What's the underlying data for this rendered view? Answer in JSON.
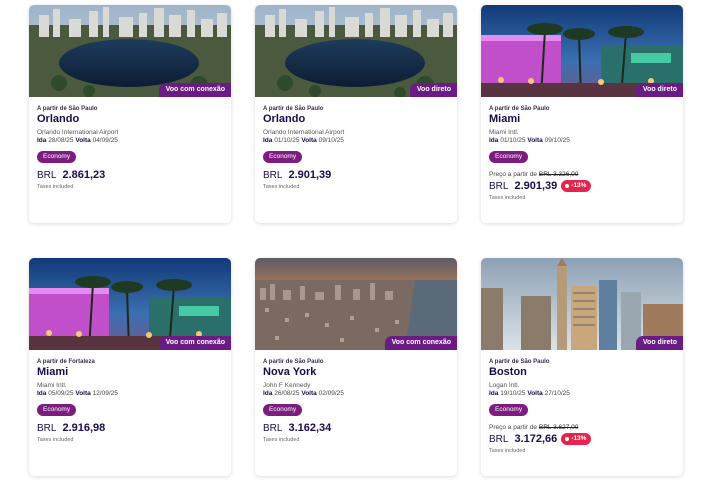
{
  "colors": {
    "badge_bg": "#6a1b84",
    "chip_bg": "#7b1c7e",
    "discount_bg": "#e6254f",
    "text_dark": "#1b0a4a"
  },
  "cards": [
    {
      "badge": "Voo com conexão",
      "origin": "A partir de São Paulo",
      "city": "Orlando",
      "airport": "Orlando International Airport",
      "ida_label": "Ida",
      "ida_date": "28/08/25",
      "volta_label": "Volta",
      "volta_date": "04/09/25",
      "fare": "Economy",
      "currency": "BRL",
      "price": "2.861,23",
      "taxes": "Taxes included",
      "image": "lake-city-skyline"
    },
    {
      "badge": "Voo direto",
      "origin": "A partir de São Paulo",
      "city": "Orlando",
      "airport": "Orlando International Airport",
      "ida_label": "Ida",
      "ida_date": "01/10/25",
      "volta_label": "Volta",
      "volta_date": "09/10/25",
      "fare": "Economy",
      "currency": "BRL",
      "price": "2.901,39",
      "taxes": "Taxes included",
      "image": "lake-city-skyline"
    },
    {
      "badge": "Voo direto",
      "origin": "A partir de São Paulo",
      "city": "Miami",
      "airport": "Miami Intl.",
      "ida_label": "Ida",
      "ida_date": "01/10/25",
      "volta_label": "Volta",
      "volta_date": "09/10/25",
      "fare": "Economy",
      "from_price_label": "Preço a partir de",
      "old_price": "BRL 3.326,00",
      "currency": "BRL",
      "price": "2.901,39",
      "discount": "-13%",
      "taxes": "Taxes included",
      "image": "neon-palm-street"
    },
    {
      "badge": "Voo com conexão",
      "origin": "A partir de Fortaleza",
      "city": "Miami",
      "airport": "Miami Intl.",
      "ida_label": "Ida",
      "ida_date": "05/09/25",
      "volta_label": "Volta",
      "volta_date": "12/09/25",
      "fare": "Economy",
      "currency": "BRL",
      "price": "2.916,98",
      "taxes": "Taxes included",
      "image": "neon-palm-street"
    },
    {
      "badge": "Voo com conexão",
      "origin": "A partir de São Paulo",
      "city": "Nova York",
      "airport": "John F Kennedy",
      "ida_label": "Ida",
      "ida_date": "26/08/25",
      "volta_label": "Volta",
      "volta_date": "02/09/25",
      "fare": "Economy",
      "currency": "BRL",
      "price": "3.162,34",
      "taxes": "Taxes included",
      "image": "aerial-city-sunset"
    },
    {
      "badge": "Voo direto",
      "origin": "A partir de São Paulo",
      "city": "Boston",
      "airport": "Logan Intl.",
      "ida_label": "Ida",
      "ida_date": "19/10/25",
      "volta_label": "Volta",
      "volta_date": "27/10/25",
      "fare": "Economy",
      "from_price_label": "Preço a partir de",
      "old_price": "BRL 3.627,00",
      "currency": "BRL",
      "price": "3.172,66",
      "discount": "-13%",
      "taxes": "Taxes included",
      "image": "clock-tower-skyline"
    }
  ]
}
